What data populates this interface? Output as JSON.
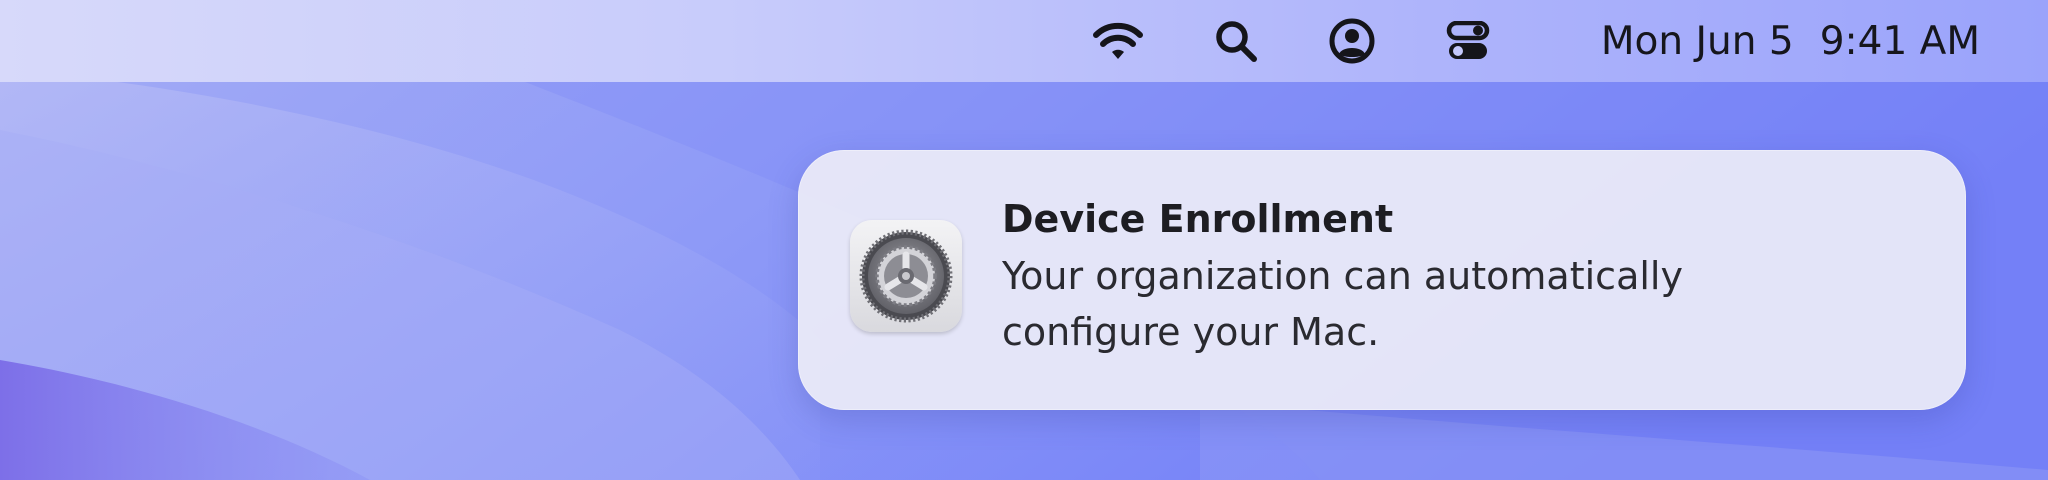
{
  "menubar": {
    "status_icons": [
      "wifi-icon",
      "spotlight-search-icon",
      "user-account-icon",
      "control-center-icon"
    ],
    "date": "Mon Jun 5",
    "time": "9:41 AM"
  },
  "notification": {
    "app_icon": "system-settings-gear-icon",
    "title": "Device Enrollment",
    "body": "Your organization can automatically configure your Mac."
  },
  "colors": {
    "wallpaper": "#7f8df6",
    "menubar_text": "#16161c",
    "notification_bg": "#ececf8"
  }
}
